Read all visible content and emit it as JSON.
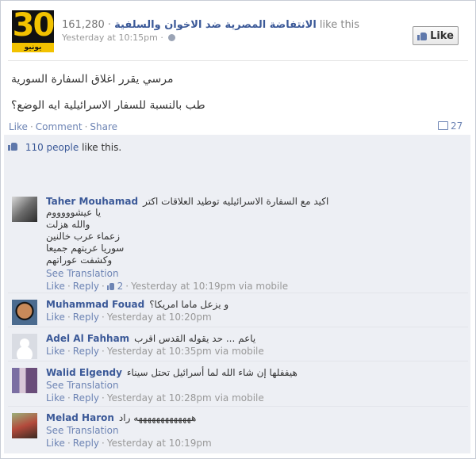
{
  "header": {
    "logo_number": "30",
    "logo_sub": "يونيو",
    "fan_count": "161,280",
    "page_name": "الانتفاضة المصرية ضد الاخوان والسلفية",
    "likes_this": "like this",
    "timestamp": "Yesterday at 10:15pm",
    "like_button": "Like"
  },
  "post": {
    "line1": "مرسي يقرر اغلاق السفارة السورية",
    "line2": "طب بالنسبة للسفار الاسرائيلية ايه الوضع؟"
  },
  "actions": {
    "like": "Like",
    "comment": "Comment",
    "share": "Share",
    "comment_count": "27"
  },
  "likes": {
    "people": "110 people",
    "rest": "like this."
  },
  "comments": [
    {
      "name": "Taher Mouhamad",
      "lines": [
        "اكيد مع السفارة الاسرائيليه توطيد العلاقات اكتر",
        "يا عيشوووووم",
        "والله هزلت",
        "زعماء عرب خالنين",
        "سوريا عريتهم جميعا",
        "وكشفت عوراتهم"
      ],
      "see_translation": "See Translation",
      "like": "Like",
      "reply": "Reply",
      "like_count": "2",
      "time": "Yesterday at 10:19pm via mobile"
    },
    {
      "name": "Muhammad Fouad",
      "text": "و يزعل ماما امريكا؟",
      "like": "Like",
      "reply": "Reply",
      "time": "Yesterday at 10:20pm"
    },
    {
      "name": "Adel Al Fahham",
      "text": "ياعم ... حد يقوله القدس اقرب",
      "like": "Like",
      "reply": "Reply",
      "time": "Yesterday at 10:35pm via mobile"
    },
    {
      "name": "Walid Elgendy",
      "text": "هيففلها إن شاء الله لما أسرائيل تحتل سيناء",
      "see_translation": "See Translation",
      "like": "Like",
      "reply": "Reply",
      "time": "Yesterday at 10:28pm via mobile"
    },
    {
      "name": "Melad Haron",
      "text": "هههههههههههههه راد",
      "see_translation": "See Translation",
      "like": "Like",
      "reply": "Reply",
      "time": "Yesterday at 10:19pm"
    }
  ],
  "icons": {
    "globe": "globe-icon",
    "thumb": "thumbs-up-icon",
    "comment": "comment-bubble-icon"
  },
  "colors": {
    "link": "#3b5998",
    "action": "#6d84b4",
    "ufi_background": "#edeff4"
  }
}
